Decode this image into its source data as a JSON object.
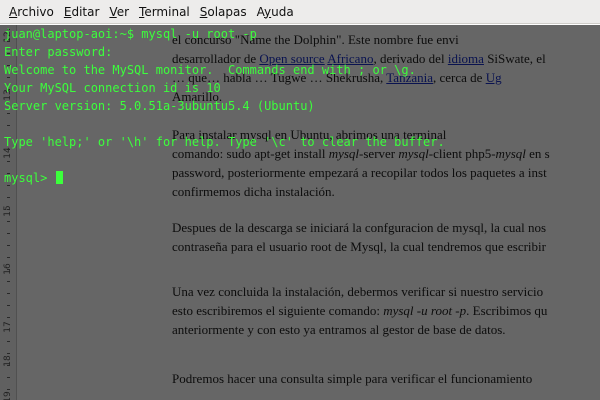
{
  "menubar": {
    "items": [
      {
        "label": "Archivo",
        "mnemonic": "A"
      },
      {
        "label": "Editar",
        "mnemonic": "E"
      },
      {
        "label": "Ver",
        "mnemonic": "V"
      },
      {
        "label": "Terminal",
        "mnemonic": "T"
      },
      {
        "label": "Solapas",
        "mnemonic": "S"
      },
      {
        "label": "Ayuda",
        "mnemonic": "y"
      }
    ]
  },
  "terminal": {
    "lines": [
      "juan@laptop-aoi:~$ mysql -u root -p",
      "Enter password:",
      "Welcome to the MySQL monitor.  Commands end with ; or \\g.",
      "Your MySQL connection id is 10",
      "Server version: 5.0.51a-3ubuntu5.4 (Ubuntu)",
      "",
      "Type 'help;' or '\\h' for help. Type '\\c' to clear the buffer.",
      "",
      "mysql> "
    ],
    "text_color": "#3cff3c"
  },
  "ruler": {
    "labels": [
      "12",
      "13",
      "14",
      "15",
      "16",
      "17",
      "18",
      "19"
    ]
  },
  "document": {
    "lines": [
      {
        "html": "el concurso \"Name the Dolphin\". Este nombre fue envi"
      },
      {
        "html": "desarrollador de <a>Open source</a> <a>Africano</a>, derivado del <a>idioma</a> SiSwate, el"
      },
      {
        "html": "… que… habla … Tugwe … Shekrusha, <a>Tanzania</a>, cerca de <a>Ug</a>"
      },
      {
        "html": "Amarillo."
      },
      {
        "html": "Para instalar mysql en Ubuntu, abrimos una terminal"
      },
      {
        "html": "comando: sudo apt-get install <em>mysql</em>-server <em>mysql</em>-client php5-<em>mysql</em> en s"
      },
      {
        "html": "password, posteriormente empezará a recopilar todos los paquetes a inst"
      },
      {
        "html": "confirmemos dicha instalación."
      },
      {
        "html": "Despues de la descarga se iniciará la confguracion de mysql, la cual nos"
      },
      {
        "html": "contraseña para el usuario root de Mysql, la cual tendremos que escribir"
      },
      {
        "html": "Una vez concluida la instalación, debermos verificar si nuestro servicio"
      },
      {
        "html": "esto escribiremos el siguiente comando: <em>mysql -u root -p</em>. Escribimos qu"
      },
      {
        "html": "anteriormente y con esto ya entramos al gestor de base de datos."
      },
      {
        "html": "Podremos hacer una consulta simple para verificar el funcionamiento"
      }
    ]
  }
}
